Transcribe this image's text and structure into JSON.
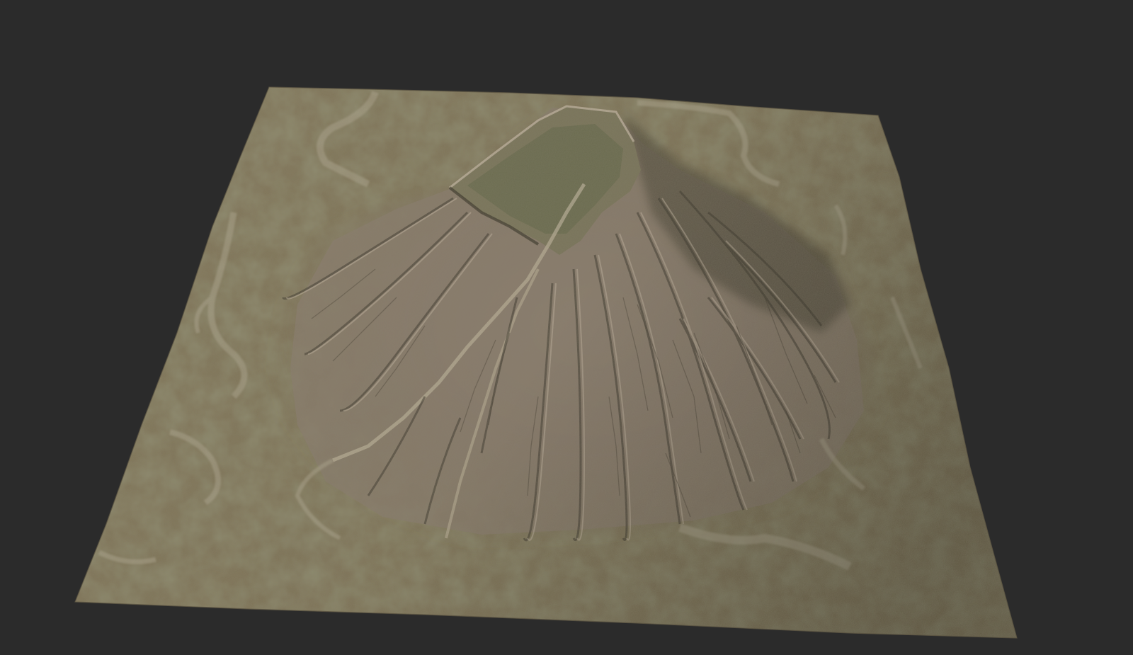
{
  "viewport": {
    "background_color": "#2b2b2b"
  },
  "terrain": {
    "subject": "terrain-mesh",
    "colors": {
      "lowland": "#857a5c",
      "lowland_dark": "#6c634a",
      "slope": "#8d7f6e",
      "ridge_highlight": "#c7b6a3",
      "ravine_shadow": "#3f3a2f",
      "vegetation": "#5f6a45",
      "dry_riverbed": "#b3ab93"
    }
  }
}
